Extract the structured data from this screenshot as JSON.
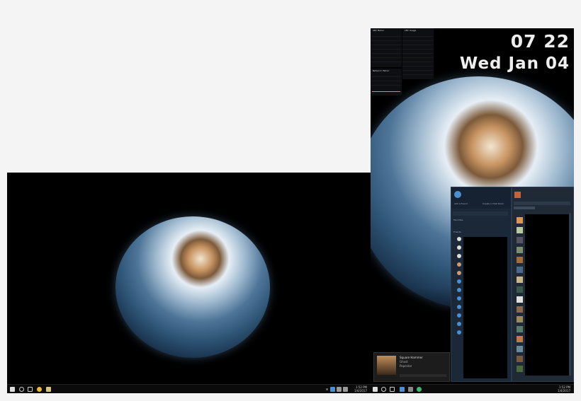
{
  "monitor_left": {
    "taskbar": {
      "time": "1:52 PM",
      "date": "1/4/2017"
    }
  },
  "monitor_right": {
    "clock": {
      "time": "07 22",
      "date": "Wed Jan 04"
    },
    "widgets": {
      "gpu_title": "GPU Meter",
      "cpu_title": "CPU Usage",
      "net_title": "Network Meter"
    },
    "steam": {
      "add_friend": "Add a Friend",
      "create_group": "Create a Chat Room",
      "favorites": "Favorites",
      "friends": "Friends"
    },
    "music": {
      "artist": "Square Hammer",
      "album": "Ghost",
      "track": "Popestar"
    },
    "taskbar": {
      "time": "1:52 PM",
      "date": "1/4/2017"
    }
  },
  "colors": {
    "desktop_bg": "#000000",
    "page_bg": "#f4f4f4",
    "steam_bg": "#1b2838",
    "accent": "#4a8fd1"
  }
}
